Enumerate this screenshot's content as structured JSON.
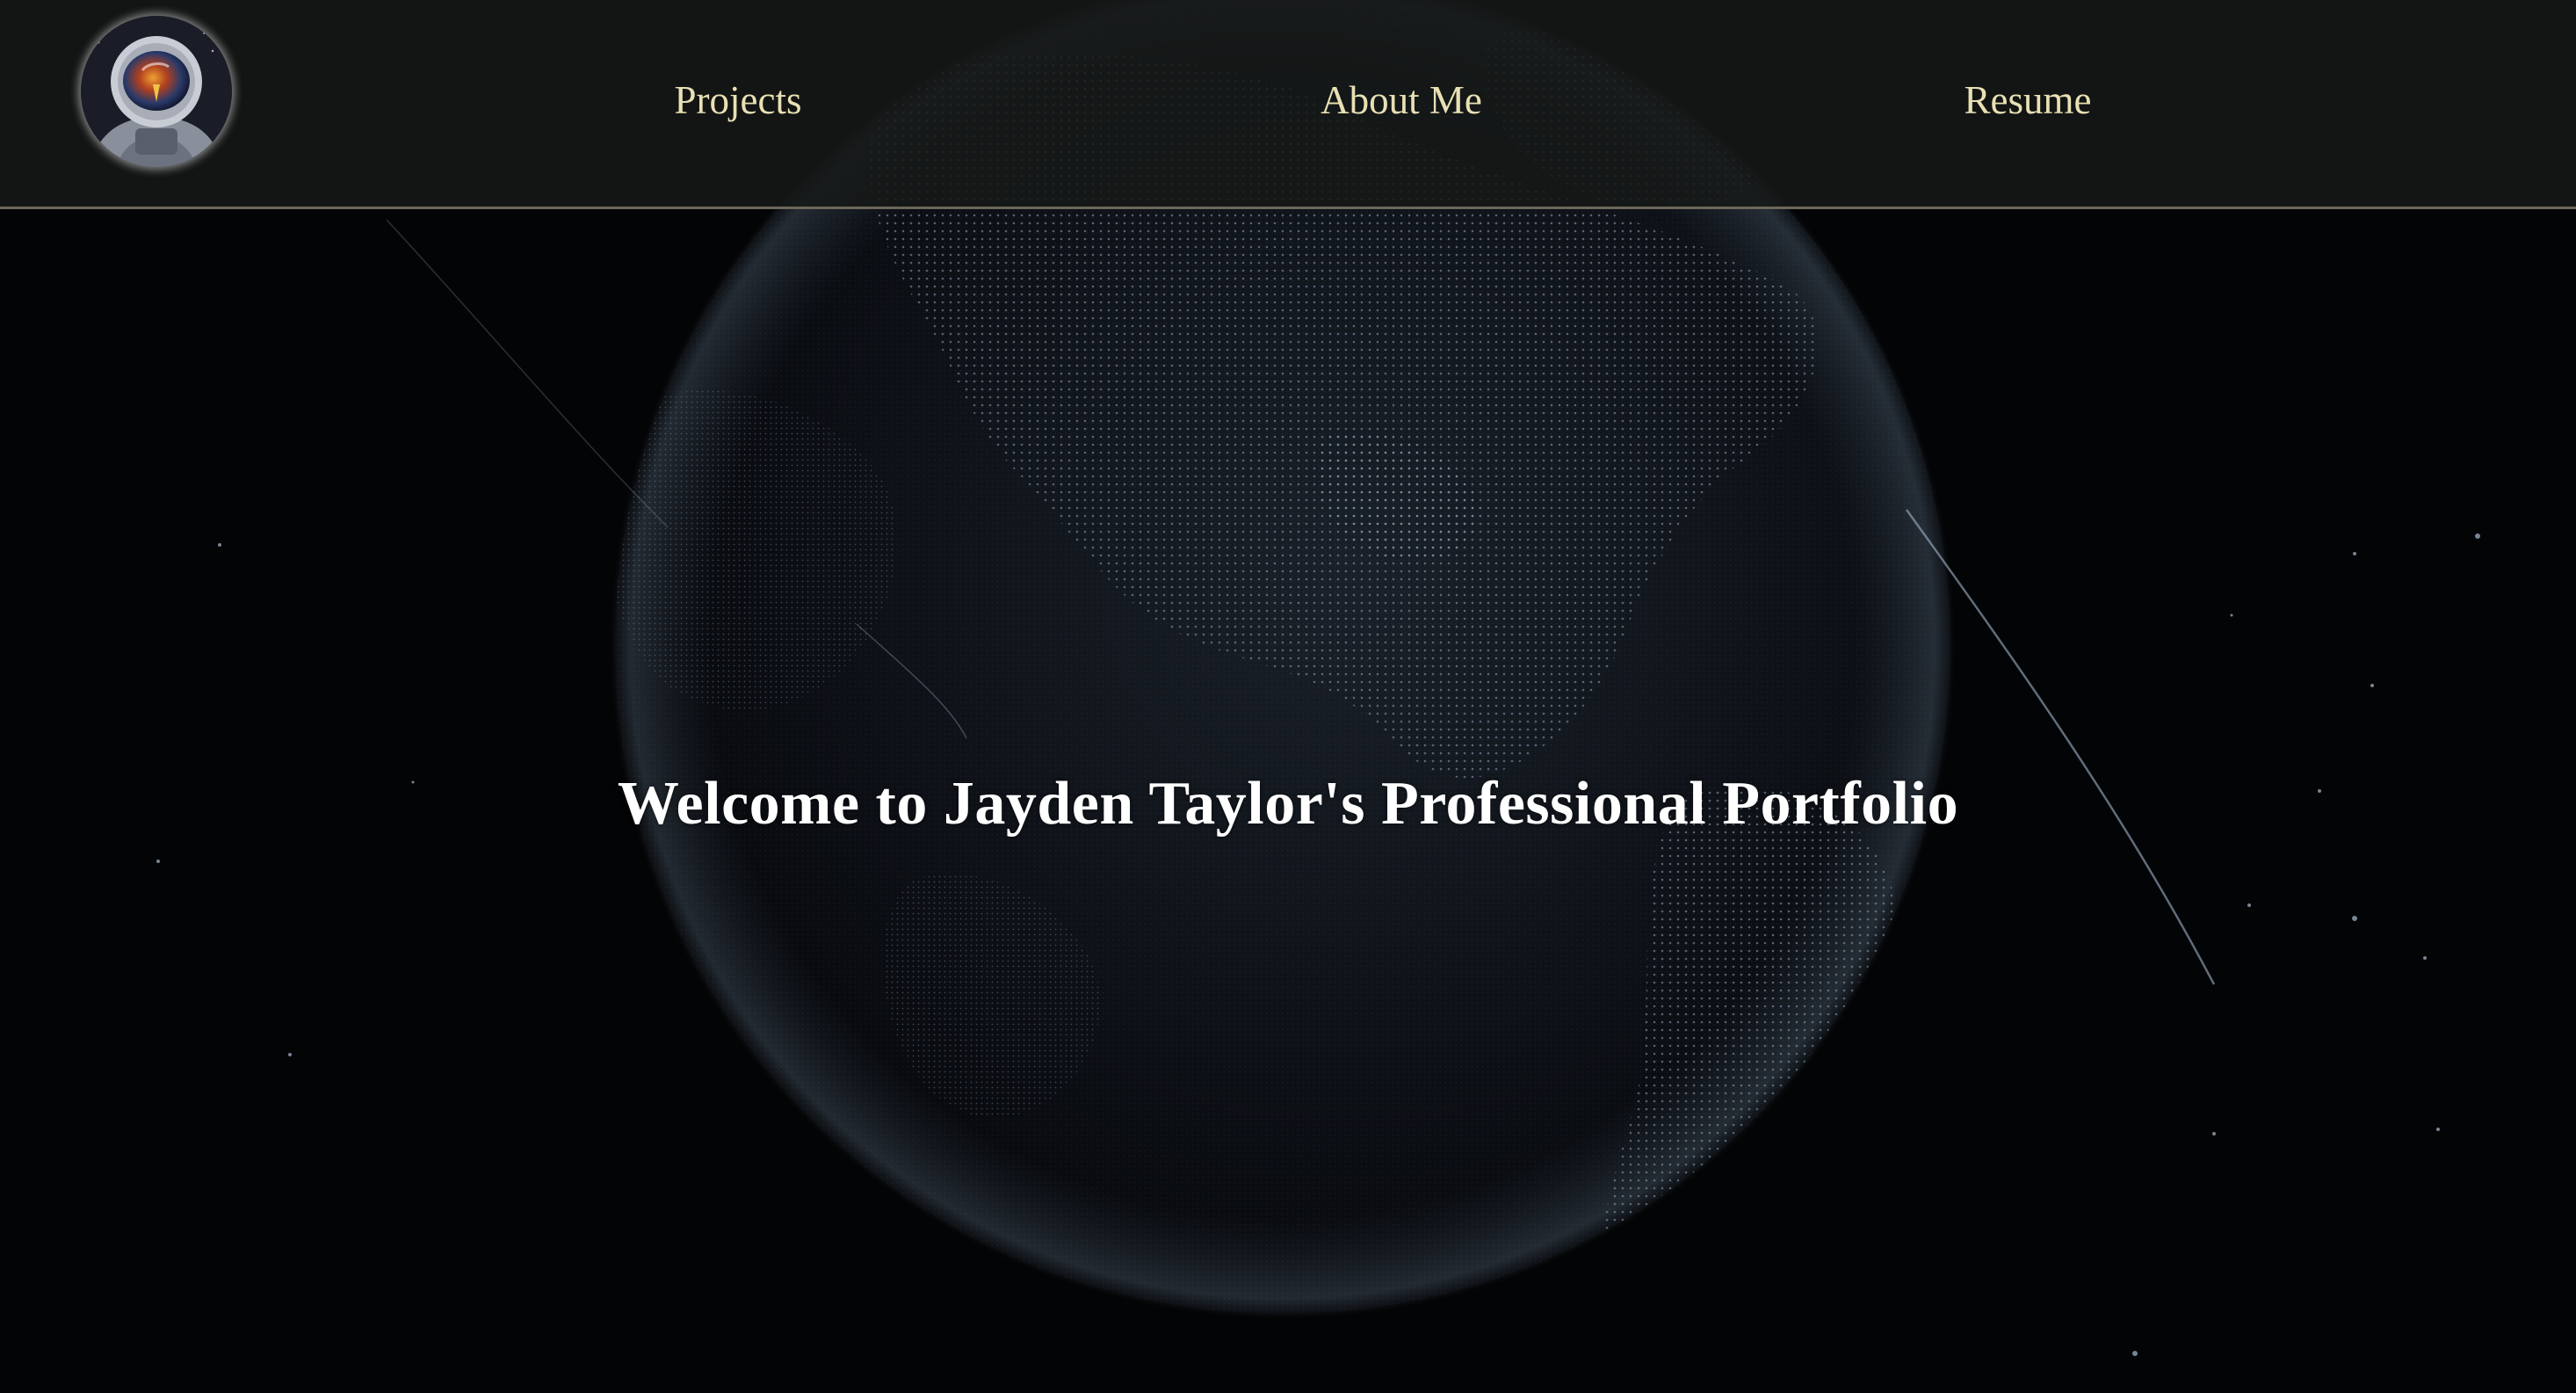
{
  "nav": {
    "avatar": "astronaut-avatar",
    "links": [
      {
        "label": "Projects"
      },
      {
        "label": "About Me"
      },
      {
        "label": "Resume"
      }
    ]
  },
  "hero": {
    "title": "Welcome to Jayden Taylor's Professional Portfolio",
    "background": "dotted-earth-globe"
  },
  "colors": {
    "page_background": "#030405",
    "navbar_background": "#161817",
    "navbar_border": "#6b675a",
    "nav_text": "#e8e0b4",
    "hero_text": "#ffffff",
    "globe_dots": "#9fb2c8"
  }
}
